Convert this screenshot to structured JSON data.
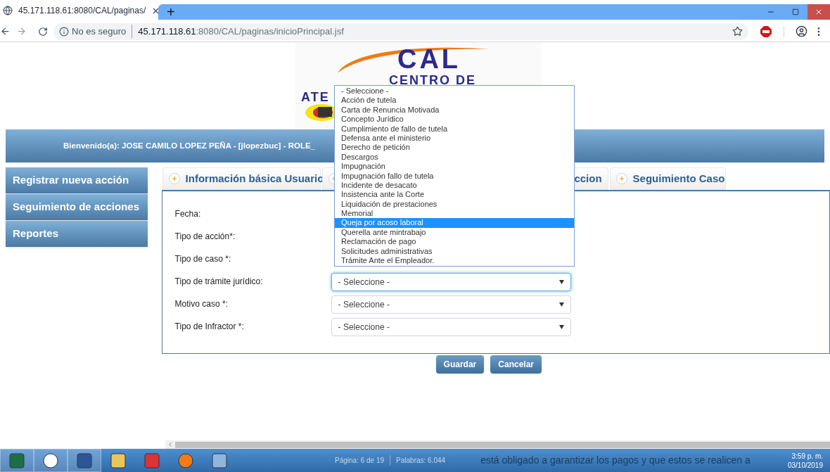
{
  "browser": {
    "tab_title": "45.171.118.61:8080/CAL/paginas/",
    "new_tab": "+",
    "security": "No es seguro",
    "url_host": "45.171.118.61",
    "url_path": ":8080/CAL/paginas/inicioPrincipal.jsf"
  },
  "logo": {
    "title": "CAL",
    "line_1": "CENTRO DE",
    "line_2": "ATE"
  },
  "header": {
    "welcome": "Bienvenido(a): JOSE CAMILO LOPEZ PEÑA - [jlopezbuc] - ROLE_"
  },
  "sidebar": {
    "items": [
      {
        "label": "Registrar nueva acción"
      },
      {
        "label": "Seguimiento de acciones"
      },
      {
        "label": "Reportes"
      }
    ]
  },
  "tabs": [
    {
      "label": "Información básica Usuario",
      "selected": false
    },
    {
      "selected": false
    },
    {
      "label": "ccion",
      "selected": false
    },
    {
      "label": "Seguimiento Caso",
      "selected": false
    }
  ],
  "form": {
    "fields": [
      {
        "label": "Fecha:",
        "kind": "text"
      },
      {
        "label": "Tipo de acción*:",
        "kind": "hidden"
      },
      {
        "label": "Tipo de caso *:",
        "kind": "hidden"
      },
      {
        "label": "Tipo de trámite jurídico:",
        "kind": "select",
        "value": "- Seleccione -",
        "focused": true
      },
      {
        "label": "Motivo caso *:",
        "kind": "select",
        "value": "- Seleccione -",
        "focused": false
      },
      {
        "label": "Tipo de Infractor *:",
        "kind": "select",
        "value": "- Seleccione -",
        "focused": false
      }
    ]
  },
  "dropdown": {
    "options": [
      {
        "label": "- Seleccione -",
        "selected": false
      },
      {
        "label": "Acción de tutela",
        "selected": false
      },
      {
        "label": "Carta de Renuncia Motivada",
        "selected": false
      },
      {
        "label": "Concepto Jurídico",
        "selected": false
      },
      {
        "label": "Cumplimiento de fallo de tutela",
        "selected": false
      },
      {
        "label": "Defensa ante el ministerio",
        "selected": false
      },
      {
        "label": "Derecho de petición",
        "selected": false
      },
      {
        "label": "Descargos",
        "selected": false
      },
      {
        "label": "Impugnación",
        "selected": false
      },
      {
        "label": "Impugnación fallo de tutela",
        "selected": false
      },
      {
        "label": "Incidente de desacato",
        "selected": false
      },
      {
        "label": "Insistencia ante la Corte",
        "selected": false
      },
      {
        "label": "Liquidación de prestaciones",
        "selected": false
      },
      {
        "label": "Memorial",
        "selected": false
      },
      {
        "label": "Queja por acoso laboral",
        "selected": true
      },
      {
        "label": "Querella ante mintrabajo",
        "selected": false
      },
      {
        "label": "Reclamación de pago",
        "selected": false
      },
      {
        "label": "Solicitudes administrativas",
        "selected": false
      },
      {
        "label": "Trámite Ante el Empleador.",
        "selected": false
      }
    ]
  },
  "buttons": [
    "Guardar",
    "Cancelar"
  ],
  "taskbar": {
    "status": "Página: 6 de 19",
    "words": "Palabras: 6.044",
    "doc_text": "está obligado a garantizar los pagos y que estos se realicen a",
    "time": "3:59 p. m.",
    "date": "03/10/2019"
  }
}
